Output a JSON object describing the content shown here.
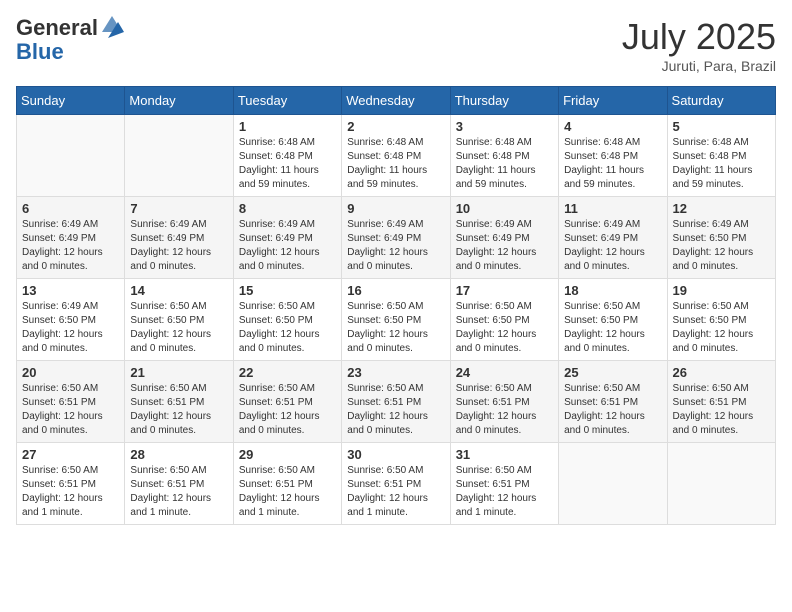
{
  "header": {
    "logo_general": "General",
    "logo_blue": "Blue",
    "month_title": "July 2025",
    "subtitle": "Juruti, Para, Brazil"
  },
  "days_of_week": [
    "Sunday",
    "Monday",
    "Tuesday",
    "Wednesday",
    "Thursday",
    "Friday",
    "Saturday"
  ],
  "weeks": [
    [
      {
        "day": "",
        "info": ""
      },
      {
        "day": "",
        "info": ""
      },
      {
        "day": "1",
        "info": "Sunrise: 6:48 AM\nSunset: 6:48 PM\nDaylight: 11 hours\nand 59 minutes."
      },
      {
        "day": "2",
        "info": "Sunrise: 6:48 AM\nSunset: 6:48 PM\nDaylight: 11 hours\nand 59 minutes."
      },
      {
        "day": "3",
        "info": "Sunrise: 6:48 AM\nSunset: 6:48 PM\nDaylight: 11 hours\nand 59 minutes."
      },
      {
        "day": "4",
        "info": "Sunrise: 6:48 AM\nSunset: 6:48 PM\nDaylight: 11 hours\nand 59 minutes."
      },
      {
        "day": "5",
        "info": "Sunrise: 6:48 AM\nSunset: 6:48 PM\nDaylight: 11 hours\nand 59 minutes."
      }
    ],
    [
      {
        "day": "6",
        "info": "Sunrise: 6:49 AM\nSunset: 6:49 PM\nDaylight: 12 hours\nand 0 minutes."
      },
      {
        "day": "7",
        "info": "Sunrise: 6:49 AM\nSunset: 6:49 PM\nDaylight: 12 hours\nand 0 minutes."
      },
      {
        "day": "8",
        "info": "Sunrise: 6:49 AM\nSunset: 6:49 PM\nDaylight: 12 hours\nand 0 minutes."
      },
      {
        "day": "9",
        "info": "Sunrise: 6:49 AM\nSunset: 6:49 PM\nDaylight: 12 hours\nand 0 minutes."
      },
      {
        "day": "10",
        "info": "Sunrise: 6:49 AM\nSunset: 6:49 PM\nDaylight: 12 hours\nand 0 minutes."
      },
      {
        "day": "11",
        "info": "Sunrise: 6:49 AM\nSunset: 6:49 PM\nDaylight: 12 hours\nand 0 minutes."
      },
      {
        "day": "12",
        "info": "Sunrise: 6:49 AM\nSunset: 6:50 PM\nDaylight: 12 hours\nand 0 minutes."
      }
    ],
    [
      {
        "day": "13",
        "info": "Sunrise: 6:49 AM\nSunset: 6:50 PM\nDaylight: 12 hours\nand 0 minutes."
      },
      {
        "day": "14",
        "info": "Sunrise: 6:50 AM\nSunset: 6:50 PM\nDaylight: 12 hours\nand 0 minutes."
      },
      {
        "day": "15",
        "info": "Sunrise: 6:50 AM\nSunset: 6:50 PM\nDaylight: 12 hours\nand 0 minutes."
      },
      {
        "day": "16",
        "info": "Sunrise: 6:50 AM\nSunset: 6:50 PM\nDaylight: 12 hours\nand 0 minutes."
      },
      {
        "day": "17",
        "info": "Sunrise: 6:50 AM\nSunset: 6:50 PM\nDaylight: 12 hours\nand 0 minutes."
      },
      {
        "day": "18",
        "info": "Sunrise: 6:50 AM\nSunset: 6:50 PM\nDaylight: 12 hours\nand 0 minutes."
      },
      {
        "day": "19",
        "info": "Sunrise: 6:50 AM\nSunset: 6:50 PM\nDaylight: 12 hours\nand 0 minutes."
      }
    ],
    [
      {
        "day": "20",
        "info": "Sunrise: 6:50 AM\nSunset: 6:51 PM\nDaylight: 12 hours\nand 0 minutes."
      },
      {
        "day": "21",
        "info": "Sunrise: 6:50 AM\nSunset: 6:51 PM\nDaylight: 12 hours\nand 0 minutes."
      },
      {
        "day": "22",
        "info": "Sunrise: 6:50 AM\nSunset: 6:51 PM\nDaylight: 12 hours\nand 0 minutes."
      },
      {
        "day": "23",
        "info": "Sunrise: 6:50 AM\nSunset: 6:51 PM\nDaylight: 12 hours\nand 0 minutes."
      },
      {
        "day": "24",
        "info": "Sunrise: 6:50 AM\nSunset: 6:51 PM\nDaylight: 12 hours\nand 0 minutes."
      },
      {
        "day": "25",
        "info": "Sunrise: 6:50 AM\nSunset: 6:51 PM\nDaylight: 12 hours\nand 0 minutes."
      },
      {
        "day": "26",
        "info": "Sunrise: 6:50 AM\nSunset: 6:51 PM\nDaylight: 12 hours\nand 0 minutes."
      }
    ],
    [
      {
        "day": "27",
        "info": "Sunrise: 6:50 AM\nSunset: 6:51 PM\nDaylight: 12 hours\nand 1 minute."
      },
      {
        "day": "28",
        "info": "Sunrise: 6:50 AM\nSunset: 6:51 PM\nDaylight: 12 hours\nand 1 minute."
      },
      {
        "day": "29",
        "info": "Sunrise: 6:50 AM\nSunset: 6:51 PM\nDaylight: 12 hours\nand 1 minute."
      },
      {
        "day": "30",
        "info": "Sunrise: 6:50 AM\nSunset: 6:51 PM\nDaylight: 12 hours\nand 1 minute."
      },
      {
        "day": "31",
        "info": "Sunrise: 6:50 AM\nSunset: 6:51 PM\nDaylight: 12 hours\nand 1 minute."
      },
      {
        "day": "",
        "info": ""
      },
      {
        "day": "",
        "info": ""
      }
    ]
  ]
}
